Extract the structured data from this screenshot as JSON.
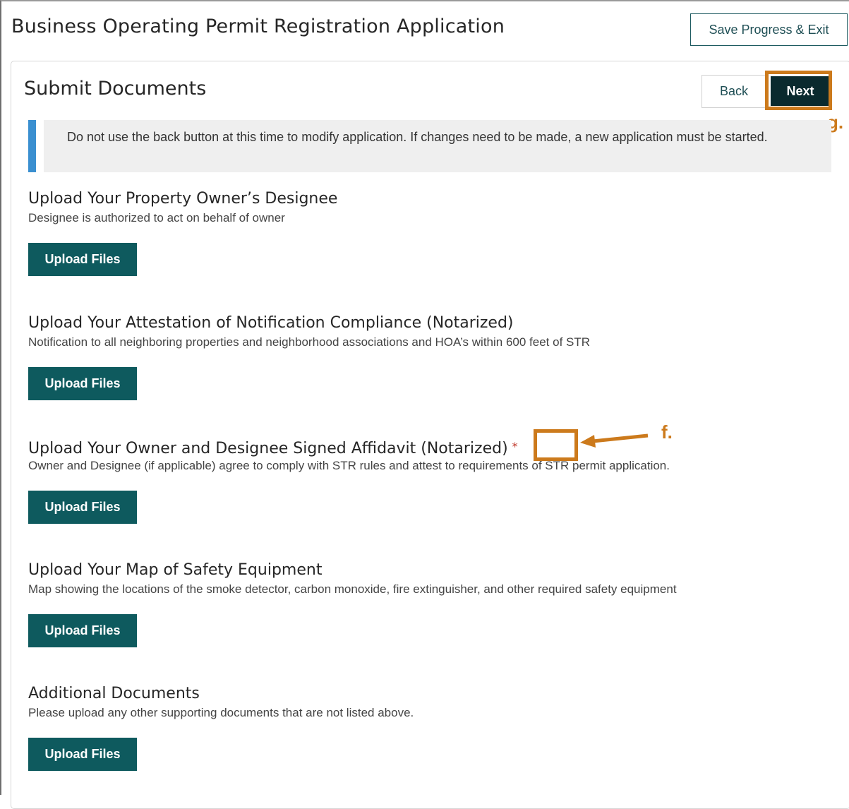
{
  "app": {
    "title": "Business Operating Permit Registration Application",
    "save_exit_label": "Save Progress & Exit"
  },
  "page": {
    "title": "Submit Documents",
    "back_label": "Back",
    "next_label": "Next"
  },
  "notice": {
    "text": "Do not use the back button at this time to modify application. If changes need to be made, a new application must be started."
  },
  "sections": [
    {
      "heading": "Upload Your Property Owner’s Designee",
      "description": "Designee is authorized to act on behalf of owner",
      "button_label": "Upload Files",
      "required": false
    },
    {
      "heading": "Upload Your Attestation of Notification Compliance (Notarized)",
      "description": "Notification to all neighboring properties and neighborhood associations and HOA’s within 600 feet of STR",
      "button_label": "Upload Files",
      "required": false
    },
    {
      "heading": "Upload Your Owner and Designee Signed Affidavit (Notarized)",
      "required_mark": "*",
      "description": "Owner and Designee (if applicable) agree to comply with STR rules and attest to requirements of STR permit application.",
      "button_label": "Upload Files",
      "required": true
    },
    {
      "heading": "Upload Your Map of Safety Equipment",
      "description": "Map showing the locations of the smoke detector, carbon monoxide, fire extinguisher, and other required safety equipment",
      "button_label": "Upload Files",
      "required": false
    },
    {
      "heading": "Additional Documents",
      "description": "Please upload any other supporting documents that are not listed above.",
      "button_label": "Upload Files",
      "required": false
    }
  ],
  "annotations": {
    "next_label": "g.",
    "required_label": "f.",
    "color": "#cc7a1c"
  }
}
